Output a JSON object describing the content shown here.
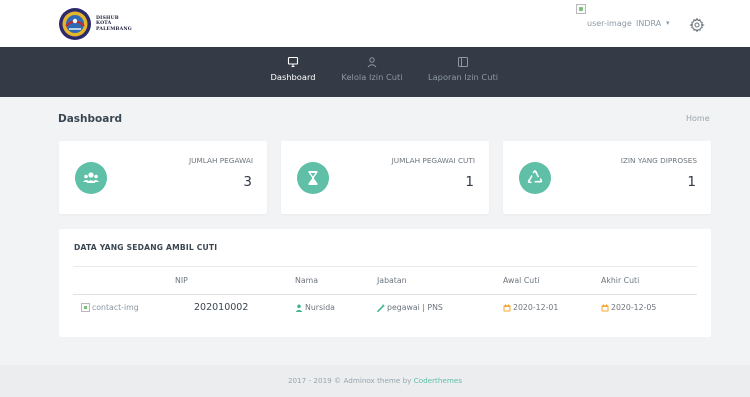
{
  "header": {
    "logo_lines": [
      "DISHUB",
      "KOTA",
      "PALEMBANG"
    ],
    "user_image_alt": "user-image",
    "user_name": "INDRA",
    "user_caret": "▾",
    "settings_icon": "gear-icon"
  },
  "nav": {
    "items": [
      {
        "label": "Dashboard",
        "icon": "monitor-icon",
        "active": true
      },
      {
        "label": "Kelola Izin Cuti",
        "icon": "user-icon",
        "active": false
      },
      {
        "label": "Laporan Izin Cuti",
        "icon": "panel-icon",
        "active": false
      }
    ]
  },
  "page": {
    "title": "Dashboard",
    "breadcrumb": "Home"
  },
  "stats": [
    {
      "label": "JUMLAH PEGAWAI",
      "value": "3",
      "icon": "users-icon",
      "color": "#5fbfa7"
    },
    {
      "label": "JUMLAH PEGAWAI CUTI",
      "value": "1",
      "icon": "hourglass-icon",
      "color": "#5fbfa7"
    },
    {
      "label": "IZIN YANG DIPROSES",
      "value": "1",
      "icon": "recycle-icon",
      "color": "#5fbfa7"
    }
  ],
  "table": {
    "title": "DATA YANG SEDANG AMBIL CUTI",
    "columns": [
      "NIP",
      "Nama",
      "Jabatan",
      "Awal Cuti",
      "Akhir Cuti"
    ],
    "rows": [
      {
        "image_alt": "contact-img",
        "nip": "202010002",
        "nama": "Nursida",
        "jabatan": "pegawai | PNS",
        "awal": "2020-12-01",
        "akhir": "2020-12-05"
      }
    ]
  },
  "footer": {
    "text": "2017 - 2019 © Adminox theme by ",
    "link": "Coderthemes"
  },
  "colors": {
    "accent": "#5fbfa7",
    "navbar": "#343b46",
    "date_icon": "#f7a534",
    "user_icon": "#3fb68b"
  }
}
